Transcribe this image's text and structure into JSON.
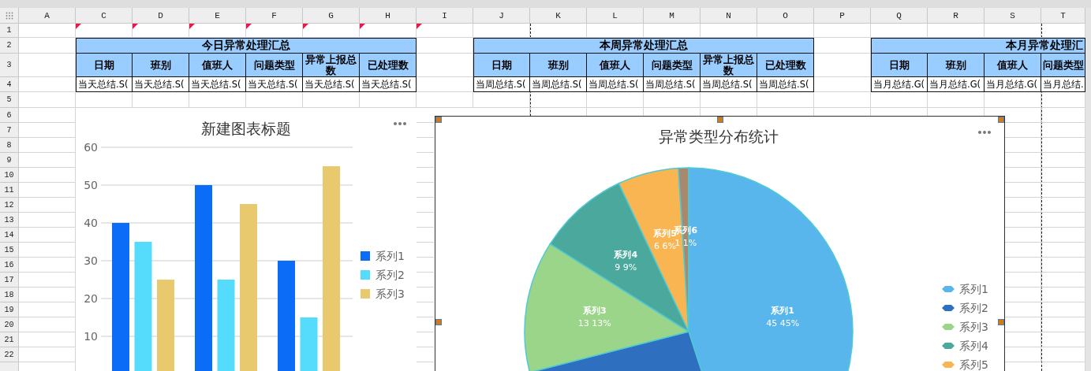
{
  "sheet": {
    "columns": [
      {
        "label": "A",
        "row1_comment": false
      },
      {
        "label": "C",
        "row1_comment": true
      },
      {
        "label": "D",
        "row1_comment": true
      },
      {
        "label": "E",
        "row1_comment": true
      },
      {
        "label": "F",
        "row1_comment": true
      },
      {
        "label": "G",
        "row1_comment": true
      },
      {
        "label": "H",
        "row1_comment": true
      },
      {
        "label": "I",
        "row1_comment": true
      },
      {
        "label": "J",
        "row1_comment": false
      },
      {
        "label": "K",
        "row1_comment": false
      },
      {
        "label": "L",
        "row1_comment": false
      },
      {
        "label": "M",
        "row1_comment": false
      },
      {
        "label": "N",
        "row1_comment": false
      },
      {
        "label": "O",
        "row1_comment": false
      },
      {
        "label": "P",
        "row1_comment": false
      },
      {
        "label": "Q",
        "row1_comment": false
      },
      {
        "label": "R",
        "row1_comment": false
      },
      {
        "label": "S",
        "row1_comment": false
      },
      {
        "label": "T",
        "row1_comment": false
      }
    ],
    "rows": [
      "1",
      "2",
      "3",
      "4",
      "5",
      "6",
      "7",
      "8",
      "9",
      "10",
      "11",
      "12",
      "13",
      "14",
      "15",
      "16",
      "17",
      "18",
      "19",
      "20",
      "21",
      "22"
    ],
    "tables": [
      {
        "title": "今日异常处理汇总",
        "headers": [
          "日期",
          "班别",
          "值班人",
          "问题类型",
          "异常上报总数",
          "已处理数"
        ],
        "cells": [
          "当天总结.S(",
          "当天总结.S(",
          "当天总结.S(",
          "当天总结.S(",
          "当天总结.S(",
          "当天总结.S("
        ]
      },
      {
        "title": "本周异常处理汇总",
        "headers": [
          "日期",
          "班别",
          "值班人",
          "问题类型",
          "异常上报总数",
          "已处理数"
        ],
        "cells": [
          "当周总结.S(",
          "当周总结.S(",
          "当周总结.S(",
          "当周总结.S(",
          "当周总结.S(",
          "当周总结.S("
        ]
      },
      {
        "title": "本月异常处理汇",
        "headers": [
          "日期",
          "班别",
          "值班人",
          "问题类型"
        ],
        "cells": [
          "当月总结.G(",
          "当月总结.G(",
          "当月总结.G(",
          "当月总结."
        ]
      }
    ]
  },
  "bar_chart": {
    "chart_data": {
      "type": "bar",
      "title": "新建图表标题",
      "ylim": [
        0,
        60
      ],
      "yticks": [
        10,
        20,
        30,
        40,
        50,
        60
      ],
      "grid": true,
      "legend": "right",
      "series": [
        {
          "name": "系列1",
          "color": "#0a6cf7",
          "values": [
            40,
            50,
            30
          ]
        },
        {
          "name": "系列2",
          "color": "#55dcfd",
          "values": [
            35,
            25,
            15
          ]
        },
        {
          "name": "系列3",
          "color": "#e8c96e",
          "values": [
            25,
            45,
            55
          ]
        }
      ]
    }
  },
  "pie_chart": {
    "chart_data": {
      "type": "pie",
      "title": "异常类型分布统计",
      "legend": "right",
      "value_labels": [
        "45 45%",
        null,
        "13 13%",
        "9 9%",
        "6 6%",
        "1 1%"
      ],
      "categories": [
        "系列1",
        "系列2",
        "系列3",
        "系列4",
        "系列5",
        "系列6"
      ],
      "values": [
        45,
        26,
        13,
        9,
        6,
        1
      ],
      "colors": [
        "#58b6ec",
        "#2f6fc0",
        "#9bd58a",
        "#4aa89c",
        "#f9b552",
        "#a98870"
      ]
    }
  }
}
